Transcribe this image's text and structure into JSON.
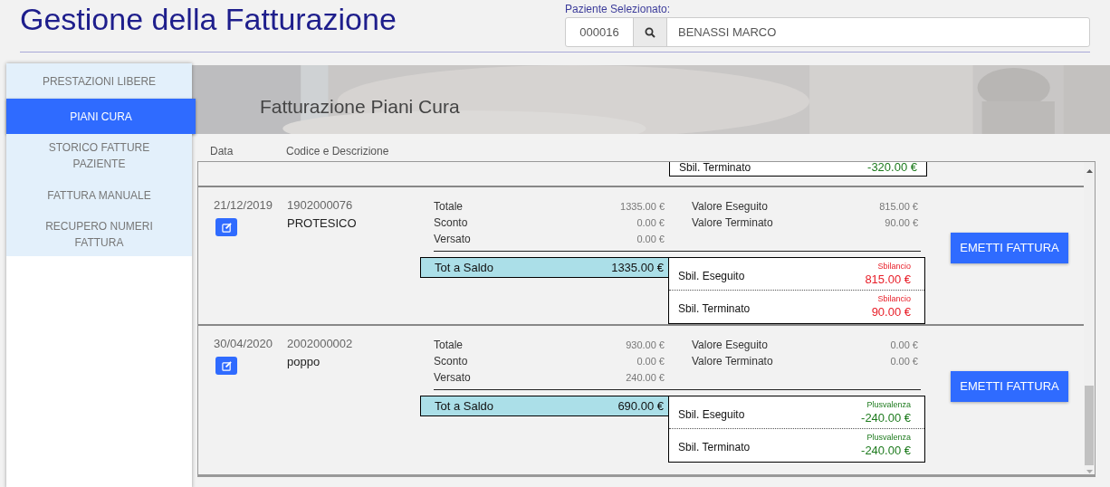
{
  "title": "Gestione della Fatturazione",
  "patient": {
    "label": "Paziente Selezionato:",
    "code": "000016",
    "name": "BENASSI MARCO"
  },
  "sidebar": {
    "items": [
      {
        "label": "PRESTAZIONI LIBERE",
        "selected": false
      },
      {
        "label": "PIANI CURA",
        "selected": true
      },
      {
        "label": "STORICO FATTURE PAZIENTE",
        "selected": false
      },
      {
        "label": "FATTURA MANUALE",
        "selected": false
      },
      {
        "label": "RECUPERO NUMERI FATTURA",
        "selected": false
      }
    ]
  },
  "banner": {
    "kind": "picture",
    "title": "Fatturazione Piani Cura"
  },
  "columns": [
    "Data",
    "Codice e Descrizione"
  ],
  "partial_row": {
    "sbil_label": "Sbil. Terminato",
    "value": "-320.00 €",
    "kind": "plusvalenza"
  },
  "rows": [
    {
      "date": "21/12/2019",
      "code": "1902000076",
      "description": "PROTESICO",
      "amounts": [
        {
          "label": "Totale",
          "value": "1335.00 €"
        },
        {
          "label": "Sconto",
          "value": "0.00 €"
        },
        {
          "label": "Versato",
          "value": "0.00 €"
        }
      ],
      "valori": [
        {
          "label": "Valore Eseguito",
          "value": "815.00 €"
        },
        {
          "label": "Valore Terminato",
          "value": "90.00 €"
        }
      ],
      "saldo": {
        "label": "Tot a Saldo",
        "value": "1335.00 €"
      },
      "sbil": [
        {
          "label": "Sbil. Eseguito",
          "kind": "sbilancio",
          "status": "Sbilancio",
          "value": "815.00 €"
        },
        {
          "label": "Sbil. Terminato",
          "kind": "sbilancio",
          "status": "Sbilancio",
          "value": "90.00 €"
        }
      ],
      "button": "EMETTI FATTURA"
    },
    {
      "date": "30/04/2020",
      "code": "2002000002",
      "description": "poppo",
      "amounts": [
        {
          "label": "Totale",
          "value": "930.00 €"
        },
        {
          "label": "Sconto",
          "value": "0.00 €"
        },
        {
          "label": "Versato",
          "value": "240.00 €"
        }
      ],
      "valori": [
        {
          "label": "Valore Eseguito",
          "value": "0.00 €"
        },
        {
          "label": "Valore Terminato",
          "value": "0.00 €"
        }
      ],
      "saldo": {
        "label": "Tot a Saldo",
        "value": "690.00 €"
      },
      "sbil": [
        {
          "label": "Sbil. Eseguito",
          "kind": "plusvalenza",
          "status": "Plusvalenza",
          "value": "-240.00 €"
        },
        {
          "label": "Sbil. Terminato",
          "kind": "plusvalenza",
          "status": "Plusvalenza",
          "value": "-240.00 €"
        }
      ],
      "button": "EMETTI FATTURA"
    }
  ]
}
